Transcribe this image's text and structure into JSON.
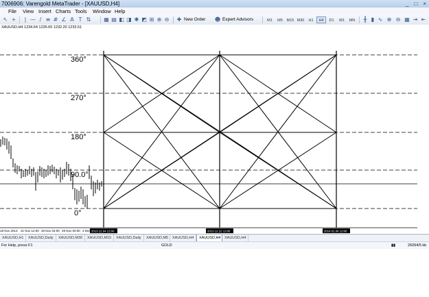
{
  "window": {
    "title": "7006906: Varengold MetaTrader - [XAUUSD,H4]",
    "controls": [
      "_",
      "□",
      "×"
    ]
  },
  "menu": {
    "items": [
      "File",
      "View",
      "Insert",
      "Charts",
      "Tools",
      "Window",
      "Help"
    ]
  },
  "toolbar": {
    "new_order_label": "New Order",
    "expert_advisors_label": "Expert Advisors",
    "timeframes": [
      "M1",
      "M5",
      "M15",
      "M30",
      "H1",
      "H4",
      "D1",
      "W1",
      "MN"
    ],
    "active_timeframe": "H4"
  },
  "chart": {
    "header": "XAUUSD,H4  1234.64 1235.65 1232.20 1233.51",
    "levels": [
      "360°",
      "270°",
      "180°",
      "90.0°",
      "0°"
    ],
    "time_labels": [
      "18 Nov 2013",
      "21 Nov 12:00",
      "26 Nov 04:00",
      "29 Nov 00:00",
      "3 Dec"
    ],
    "highlight_labels": [
      "2013.12.04 12:00",
      "2013.12.22 12:00",
      "2014.01.06 12:00"
    ],
    "colors": {
      "background": "#ffffff",
      "lines": "#000000",
      "grid": "#000000"
    }
  },
  "tabs": {
    "items": [
      "XAUUSD,H1",
      "XAUUSD,Daily",
      "XAUUSD,M30",
      "XAUUSD,M15",
      "XAUUSD,Daily",
      "XAUUSD,M5",
      "XAUUSD,H4",
      "XAUUSD,H4",
      "XAUUSD,H4"
    ],
    "active_index": 7
  },
  "status": {
    "help": "For Help, press F1",
    "profile": "GOLD",
    "traffic": "26094/5 kb"
  }
}
